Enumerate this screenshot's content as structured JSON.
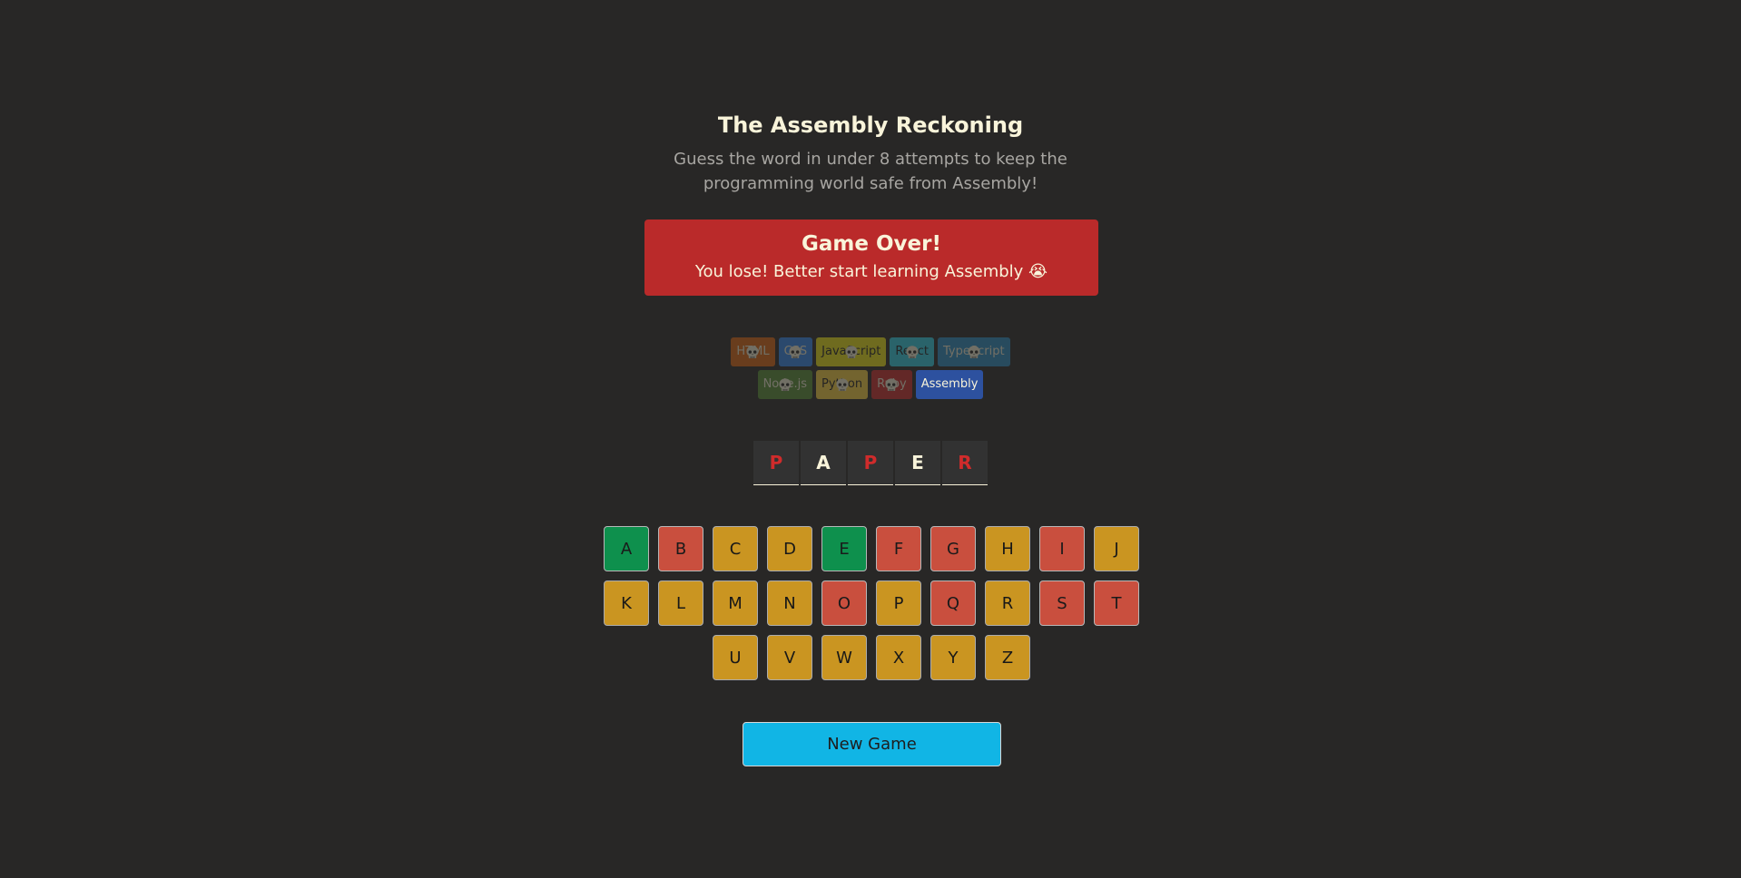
{
  "header": {
    "title": "The Assembly Reckoning",
    "subtitle": "Guess the word in under 8 attempts to keep the programming world safe from Assembly!"
  },
  "status": {
    "title": "Game Over!",
    "message": "You lose! Better start learning Assembly 😭",
    "color": "#BA2A2A"
  },
  "languages": [
    {
      "name": "HTML",
      "bg": "#E2680F",
      "fg": "#F9F4DA",
      "lost": true
    },
    {
      "name": "CSS",
      "bg": "#328AF1",
      "fg": "#F9F4DA",
      "lost": true
    },
    {
      "name": "JavaScript",
      "bg": "#F4EB13",
      "fg": "#1E1E1E",
      "lost": true
    },
    {
      "name": "React",
      "bg": "#2ED3E9",
      "fg": "#1E1E1E",
      "lost": true
    },
    {
      "name": "TypeScript",
      "bg": "#298EC6",
      "fg": "#F9F4DA",
      "lost": true
    },
    {
      "name": "Node.js",
      "bg": "#599137",
      "fg": "#F9F4DA",
      "lost": true
    },
    {
      "name": "Python",
      "bg": "#FFD742",
      "fg": "#1E1E1E",
      "lost": true
    },
    {
      "name": "Ruby",
      "bg": "#D02B2B",
      "fg": "#F9F4DA",
      "lost": true
    },
    {
      "name": "Assembly",
      "bg": "#2D519F",
      "fg": "#F9F4DA",
      "lost": false
    }
  ],
  "word": [
    {
      "letter": "P",
      "color": "#D02B2B"
    },
    {
      "letter": "A",
      "color": "#F9F4DA"
    },
    {
      "letter": "P",
      "color": "#D02B2B"
    },
    {
      "letter": "E",
      "color": "#F9F4DA"
    },
    {
      "letter": "R",
      "color": "#D02B2B"
    }
  ],
  "keyboard": [
    {
      "key": "A",
      "state": "correct"
    },
    {
      "key": "B",
      "state": "wrong"
    },
    {
      "key": "C",
      "state": "unused"
    },
    {
      "key": "D",
      "state": "unused"
    },
    {
      "key": "E",
      "state": "correct"
    },
    {
      "key": "F",
      "state": "wrong"
    },
    {
      "key": "G",
      "state": "wrong"
    },
    {
      "key": "H",
      "state": "unused"
    },
    {
      "key": "I",
      "state": "wrong"
    },
    {
      "key": "J",
      "state": "unused"
    },
    {
      "key": "K",
      "state": "unused"
    },
    {
      "key": "L",
      "state": "unused"
    },
    {
      "key": "M",
      "state": "unused"
    },
    {
      "key": "N",
      "state": "unused"
    },
    {
      "key": "O",
      "state": "wrong"
    },
    {
      "key": "P",
      "state": "unused"
    },
    {
      "key": "Q",
      "state": "wrong"
    },
    {
      "key": "R",
      "state": "unused"
    },
    {
      "key": "S",
      "state": "wrong"
    },
    {
      "key": "T",
      "state": "wrong"
    },
    {
      "key": "U",
      "state": "unused"
    },
    {
      "key": "V",
      "state": "unused"
    },
    {
      "key": "W",
      "state": "unused"
    },
    {
      "key": "X",
      "state": "unused"
    },
    {
      "key": "Y",
      "state": "unused"
    },
    {
      "key": "Z",
      "state": "unused"
    }
  ],
  "key_colors": {
    "correct": "#10A95B",
    "wrong": "#EC5D49",
    "unused": "#FCBA29"
  },
  "key_dim": {
    "correct": false,
    "wrong": true,
    "unused": true
  },
  "new_game_label": "New Game",
  "icons": {
    "lost_marker": "skull-icon"
  }
}
